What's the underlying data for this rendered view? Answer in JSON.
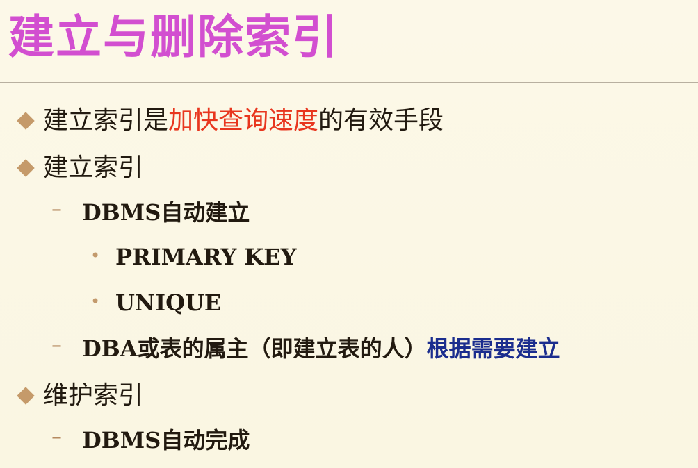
{
  "slide": {
    "title": "建立与删除索引",
    "items": [
      {
        "level": 1,
        "parts": [
          {
            "text": "建立索引是",
            "color": "#221a10"
          },
          {
            "text": "加快查询速度",
            "color": "#e8361e"
          },
          {
            "text": "的有效手段",
            "color": "#221a10"
          }
        ]
      },
      {
        "level": 1,
        "text": "建立索引"
      },
      {
        "level": 2,
        "text": "DBMS自动建立"
      },
      {
        "level": 3,
        "text": "PRIMARY  KEY"
      },
      {
        "level": 3,
        "text": "UNIQUE"
      },
      {
        "level": 2,
        "parts": [
          {
            "text": "DBA或表的属主（即建立表的人）",
            "color": "#221a10"
          },
          {
            "text": "根据需要建立",
            "color": "#1b2d8e"
          }
        ]
      },
      {
        "level": 1,
        "text": "维护索引"
      },
      {
        "level": 2,
        "text": "DBMS自动完成"
      }
    ]
  },
  "colors": {
    "title": "#d24fd0",
    "bullet": "#c59a6a",
    "emphasis_red": "#e8361e",
    "emphasis_blue": "#1b2d8e",
    "background": "#fbf7e6"
  },
  "icons": {
    "level1_bullet": "diamond-bullet",
    "level2_bullet": "dash-bullet",
    "level3_bullet": "dot-bullet"
  }
}
